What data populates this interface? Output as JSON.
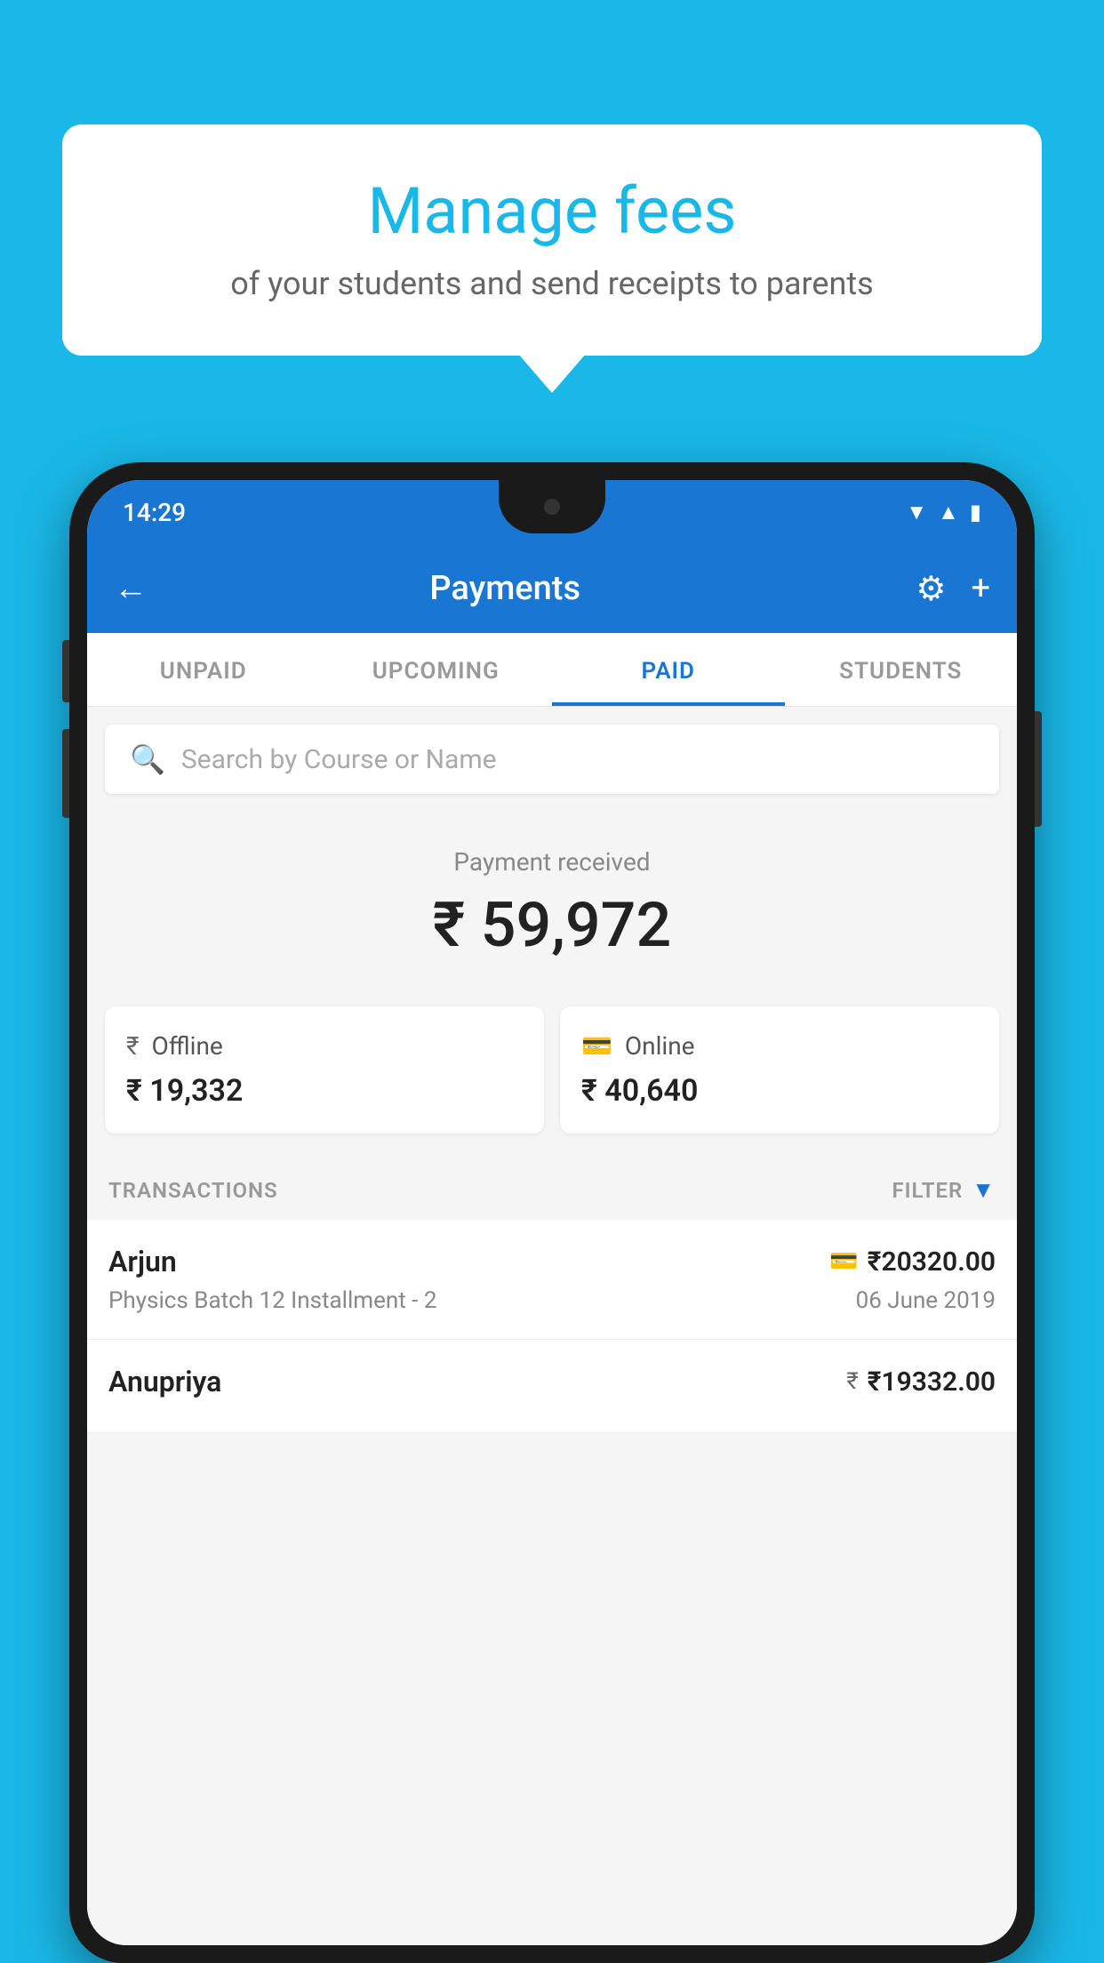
{
  "background_color": "#1ab8e8",
  "bubble": {
    "title": "Manage fees",
    "subtitle": "of your students and send receipts to parents"
  },
  "status_bar": {
    "time": "14:29"
  },
  "app_bar": {
    "title": "Payments",
    "back_label": "←"
  },
  "tabs": [
    {
      "id": "unpaid",
      "label": "UNPAID",
      "active": false
    },
    {
      "id": "upcoming",
      "label": "UPCOMING",
      "active": false
    },
    {
      "id": "paid",
      "label": "PAID",
      "active": true
    },
    {
      "id": "students",
      "label": "STUDENTS",
      "active": false
    }
  ],
  "search": {
    "placeholder": "Search by Course or Name"
  },
  "payment_received": {
    "label": "Payment received",
    "amount": "₹ 59,972"
  },
  "payment_cards": [
    {
      "type": "Offline",
      "amount": "₹ 19,332",
      "icon": "₹"
    },
    {
      "type": "Online",
      "amount": "₹ 40,640",
      "icon": "💳"
    }
  ],
  "transactions_header": {
    "label": "TRANSACTIONS",
    "filter_label": "FILTER"
  },
  "transactions": [
    {
      "name": "Arjun",
      "course": "Physics Batch 12 Installment - 2",
      "amount": "₹20320.00",
      "date": "06 June 2019",
      "type_icon": "💳"
    },
    {
      "name": "Anupriya",
      "course": "",
      "amount": "₹19332.00",
      "date": "",
      "type_icon": "₹"
    }
  ]
}
